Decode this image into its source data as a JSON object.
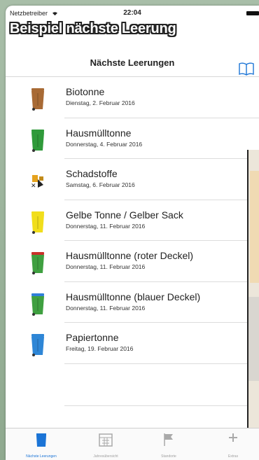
{
  "status_bar": {
    "carrier": "Netzbetreiber",
    "time": "22:04"
  },
  "banner": "Beispiel nächste Leerung",
  "navbar": {
    "title": "Nächste Leerungen",
    "book_icon": "book-icon"
  },
  "items": [
    {
      "name": "Biotonne",
      "date": "Dienstag, 2. Februar 2016",
      "icon": "bin-icon",
      "color": "#a86a35"
    },
    {
      "name": "Hausmülltonne",
      "date": "Donnerstag, 4. Februar 2016",
      "icon": "bin-icon",
      "color": "#2f9a3a"
    },
    {
      "name": "Schadstoffe",
      "date": "Samstag, 6. Februar 2016",
      "icon": "hazard-icon",
      "color": "#e5a21d"
    },
    {
      "name": "Gelbe Tonne / Gelber Sack",
      "date": "Donnerstag, 11. Februar 2016",
      "icon": "bin-icon",
      "color": "#f1de1c"
    },
    {
      "name": "Hausmülltonne (roter Deckel)",
      "date": "Donnerstag, 11. Februar 2016",
      "icon": "bin-icon",
      "color": "#3fa040",
      "lid": "#c9312a"
    },
    {
      "name": "Hausmülltonne (blauer Deckel)",
      "date": "Donnerstag, 11. Februar 2016",
      "icon": "bin-icon",
      "color": "#3fa040",
      "lid": "#2f7fd8"
    },
    {
      "name": "Papiertonne",
      "date": "Freitag, 19. Februar 2016",
      "icon": "bin-icon",
      "color": "#2e86d6"
    }
  ],
  "tabbar": {
    "tabs": [
      {
        "label": "Nächste Leerungen",
        "icon": "bin-icon",
        "active": true
      },
      {
        "label": "Jahresübersicht",
        "icon": "calendar-icon",
        "active": false
      },
      {
        "label": "Standorte",
        "icon": "flag-icon",
        "active": false
      },
      {
        "label": "Extras",
        "icon": "plus-icon",
        "active": false
      }
    ]
  },
  "colors": {
    "accent": "#1b74d6",
    "frame": "#9ab29a"
  }
}
